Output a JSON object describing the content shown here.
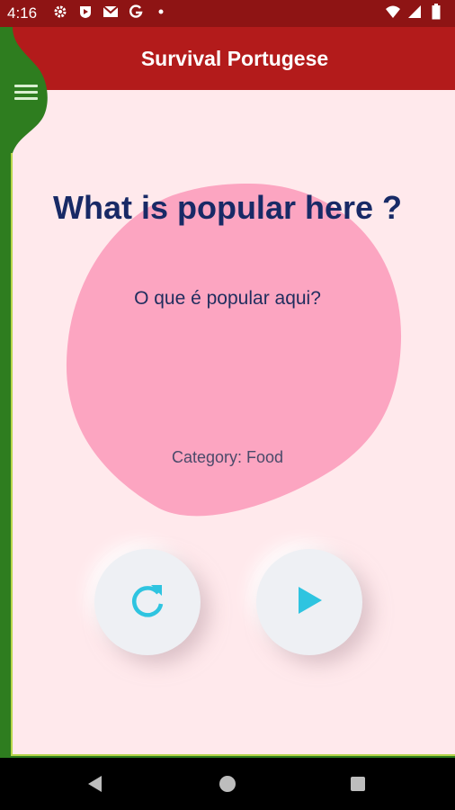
{
  "status_bar": {
    "time": "4:16",
    "left_icons": [
      "gear-icon",
      "play-shield-icon",
      "mail-icon",
      "google-icon",
      "dot-icon"
    ],
    "right_icons": [
      "wifi-icon",
      "signal-icon",
      "battery-icon"
    ]
  },
  "app": {
    "title": "Survival Portugese",
    "menu_icon": "hamburger-menu-icon",
    "colors": {
      "app_bar": "#b31b1b",
      "status_bar": "#8e1414",
      "background": "#ffe9ec",
      "drawer": "#2e7d1f",
      "blob": "#fca5c1",
      "accent": "#2ec4e0"
    }
  },
  "card": {
    "phrase": "What is popular here ?",
    "translation": "O que é popular aqui?",
    "category_label": "Category:",
    "category_value": "Food"
  },
  "actions": {
    "replay_icon": "refresh-icon",
    "play_icon": "play-icon"
  },
  "nav_bar": {
    "icons": [
      "back-icon",
      "home-icon",
      "recents-icon"
    ]
  }
}
